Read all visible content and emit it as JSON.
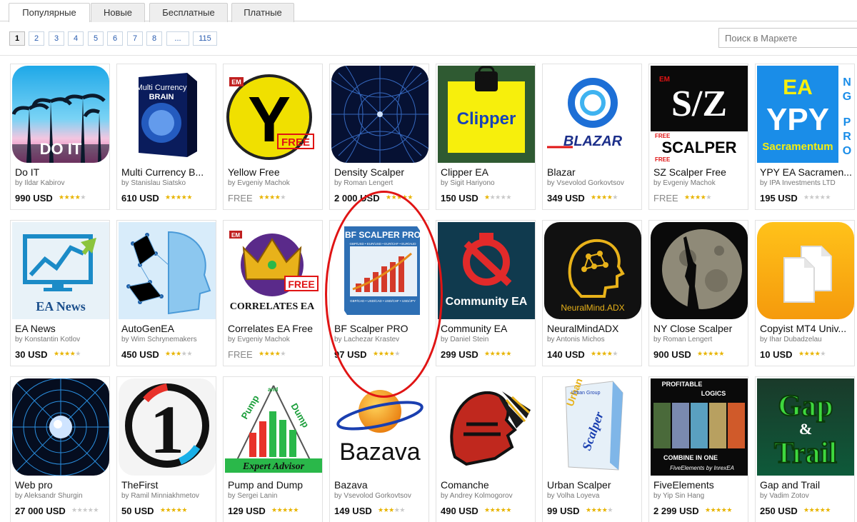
{
  "tabs": [
    {
      "label": "Популярные",
      "active": true
    },
    {
      "label": "Новые",
      "active": false
    },
    {
      "label": "Бесплатные",
      "active": false
    },
    {
      "label": "Платные",
      "active": false
    }
  ],
  "pagination": [
    "1",
    "2",
    "3",
    "4",
    "5",
    "6",
    "7",
    "8",
    "...",
    "115"
  ],
  "current_page": "1",
  "search": {
    "placeholder": "Поиск в Маркете"
  },
  "products": [
    {
      "name": "Do IT",
      "author": "by Ildar Kabirov",
      "price": "990 USD",
      "rating": 4
    },
    {
      "name": "Multi Currency B...",
      "author": "by Stanislau Siatsko",
      "price": "610 USD",
      "rating": 5
    },
    {
      "name": "Yellow Free",
      "author": "by Evgeniy Machok",
      "price": "FREE",
      "rating": 4
    },
    {
      "name": "Density Scalper",
      "author": "by Roman Lengert",
      "price": "2 000 USD",
      "rating": 5
    },
    {
      "name": "Clipper EA",
      "author": "by Sigit Hariyono",
      "price": "150 USD",
      "rating": 1
    },
    {
      "name": "Blazar",
      "author": "by Vsevolod Gorkovtsov",
      "price": "349 USD",
      "rating": 4
    },
    {
      "name": "SZ Scalper Free",
      "author": "by Evgeniy Machok",
      "price": "FREE",
      "rating": 4
    },
    {
      "name": "YPY EA Sacramen...",
      "author": "by IPA Investments LTD",
      "price": "195 USD",
      "rating": 0
    },
    {
      "name": "EA News",
      "author": "by Konstantin Kotlov",
      "price": "30 USD",
      "rating": 4
    },
    {
      "name": "AutoGenEA",
      "author": "by Wim Schrynemakers",
      "price": "450 USD",
      "rating": 3
    },
    {
      "name": "Correlates EA Free",
      "author": "by Evgeniy Machok",
      "price": "FREE",
      "rating": 4
    },
    {
      "name": "BF Scalper PRO",
      "author": "by Lachezar Krastev",
      "price": "97 USD",
      "rating": 4
    },
    {
      "name": "Community EA",
      "author": "by Daniel Stein",
      "price": "299 USD",
      "rating": 5
    },
    {
      "name": "NeuralMindADX",
      "author": "by Antonis Michos",
      "price": "140 USD",
      "rating": 4
    },
    {
      "name": "NY Close Scalper",
      "author": "by Roman Lengert",
      "price": "900 USD",
      "rating": 5
    },
    {
      "name": "Copyist MT4 Univ...",
      "author": "by Ihar Dubadzelau",
      "price": "10 USD",
      "rating": 4
    },
    {
      "name": "Web pro",
      "author": "by Aleksandr Shurgin",
      "price": "27 000 USD",
      "rating": 0
    },
    {
      "name": "TheFirst",
      "author": "by Ramil Minniakhmetov",
      "price": "50 USD",
      "rating": 5
    },
    {
      "name": "Pump and Dump",
      "author": "by Sergei Lanin",
      "price": "129 USD",
      "rating": 5
    },
    {
      "name": "Bazava",
      "author": "by Vsevolod Gorkovtsov",
      "price": "149 USD",
      "rating": 3
    },
    {
      "name": "Comanche",
      "author": "by Andrey Kolmogorov",
      "price": "490 USD",
      "rating": 5
    },
    {
      "name": "Urban Scalper",
      "author": "by Volha Loyeva",
      "price": "99 USD",
      "rating": 4
    },
    {
      "name": "FiveElements",
      "author": "by Yip Sin Hang",
      "price": "2 299 USD",
      "rating": 5
    },
    {
      "name": "Gap and Trail",
      "author": "by Vadim Zotov",
      "price": "250 USD",
      "rating": 5
    }
  ],
  "thumb_text": {
    "do_it": "DO IT",
    "multi_title": "Multi Currency",
    "multi_brain": "BRAIN",
    "em": "EM",
    "yellow_letter": "Y",
    "free": "FREE",
    "clipper": "Clipper",
    "blazar": "BLAZAR",
    "sz": "S/Z",
    "scalper": "SCALPER",
    "ypy_ea": "EA",
    "ypy": "YPY",
    "ng_pro": [
      "N",
      "G",
      "P",
      "R",
      "O"
    ],
    "sacramentum": "Sacramentum",
    "ea_news": "EA News",
    "correlates": "CORRELATES EA",
    "bf_title": "BF SCALPER PRO",
    "bf_pairs_top": "GBP/USD • EUR/USD • EUR/CHF • EUR/AUD",
    "bf_pairs_bottom": "GBP/CAD • USD/CAD • USD/CHF • USD/JPY",
    "community": "Community EA",
    "neural": "NeuralMind.ADX",
    "thefirst_digit": "1",
    "pump": "Pump",
    "and": "and",
    "dump": "Dump",
    "expert_advisor": "Expert Advisor",
    "bazava": "Bazava",
    "urban": "Urban",
    "urban_scalper": "Scalper",
    "urban_group": "Urban Group",
    "fe_profitable": "PROFITABLE",
    "fe_logics": "LOGICS",
    "fe_combine": "COMBINE IN ONE",
    "fe_by": "FiveElements by InrexEA",
    "gap": "Gap",
    "amp": "&",
    "trail": "Trail"
  },
  "colors": {
    "accent": "#2a5db0",
    "star": "#e8b400",
    "highlight_oval": "#e01414"
  }
}
